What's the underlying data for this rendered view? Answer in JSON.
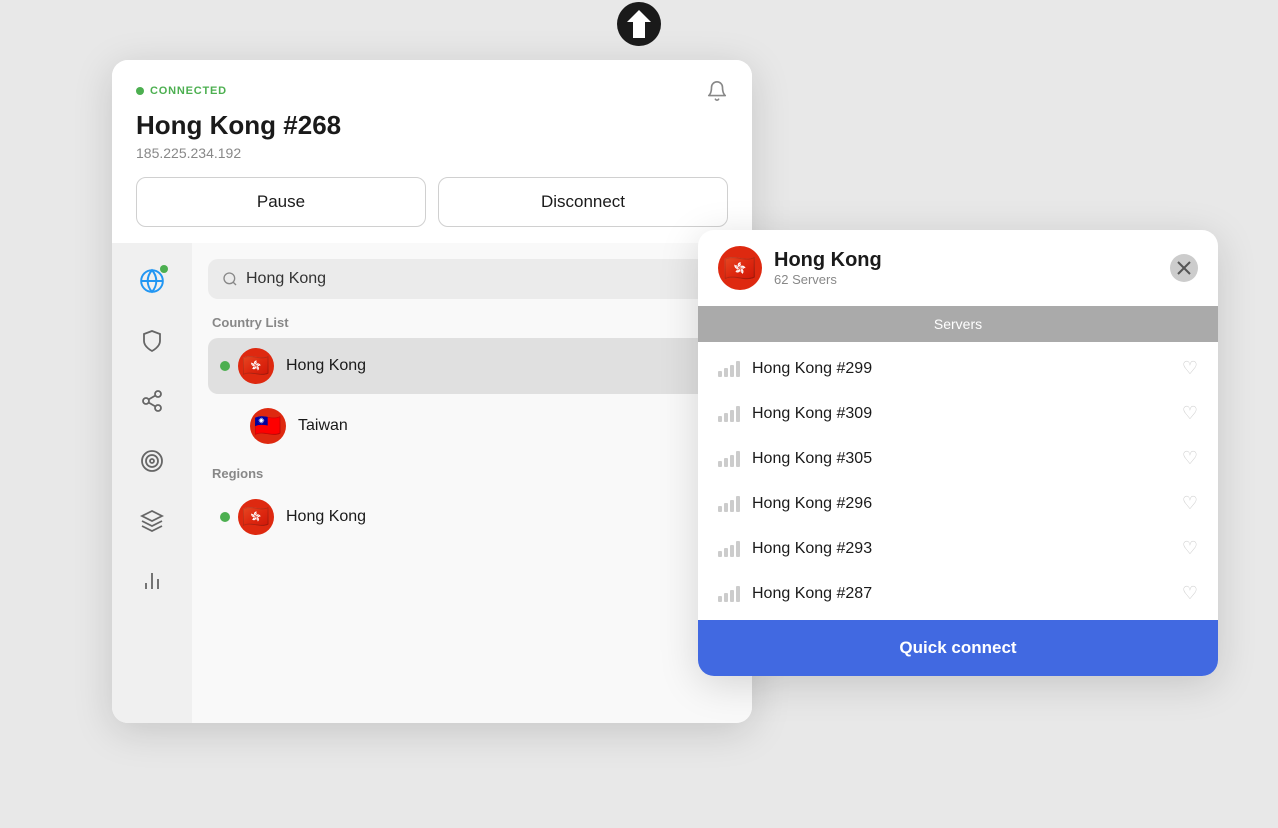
{
  "logo": {
    "aria": "ProtonVPN logo"
  },
  "header": {
    "status": "CONNECTED",
    "server_name": "Hong Kong #268",
    "ip_address": "185.225.234.192",
    "pause_label": "Pause",
    "disconnect_label": "Disconnect"
  },
  "sidebar": {
    "items": [
      {
        "name": "globe",
        "label": "Countries",
        "active": true,
        "has_dot": true
      },
      {
        "name": "shield",
        "label": "NetShield",
        "active": false,
        "has_dot": false
      },
      {
        "name": "share",
        "label": "Secure Core",
        "active": false,
        "has_dot": false
      },
      {
        "name": "target",
        "label": "Streaming",
        "active": false,
        "has_dot": false
      },
      {
        "name": "layers",
        "label": "Profiles",
        "active": false,
        "has_dot": false
      },
      {
        "name": "chart",
        "label": "Statistics",
        "active": false,
        "has_dot": false
      }
    ]
  },
  "search": {
    "placeholder": "Hong Kong",
    "value": "Hong Kong",
    "clear_aria": "Clear search"
  },
  "country_list": {
    "label": "Country List",
    "items": [
      {
        "name": "Hong Kong",
        "flag": "🇭🇰",
        "selected": true,
        "connected": true
      },
      {
        "name": "Taiwan",
        "flag": "🇹🇼",
        "selected": false,
        "connected": false
      }
    ]
  },
  "regions": {
    "label": "Regions",
    "items": [
      {
        "name": "Hong Kong",
        "flag": "🇭🇰",
        "connected": true
      }
    ]
  },
  "hk_popup": {
    "country_name": "Hong Kong",
    "servers_count": "62 Servers",
    "tab_label": "Servers",
    "servers": [
      {
        "name": "Hong Kong #299"
      },
      {
        "name": "Hong Kong #309"
      },
      {
        "name": "Hong Kong #305"
      },
      {
        "name": "Hong Kong #296"
      },
      {
        "name": "Hong Kong #293"
      },
      {
        "name": "Hong Kong #287"
      }
    ],
    "quick_connect_label": "Quick connect"
  }
}
